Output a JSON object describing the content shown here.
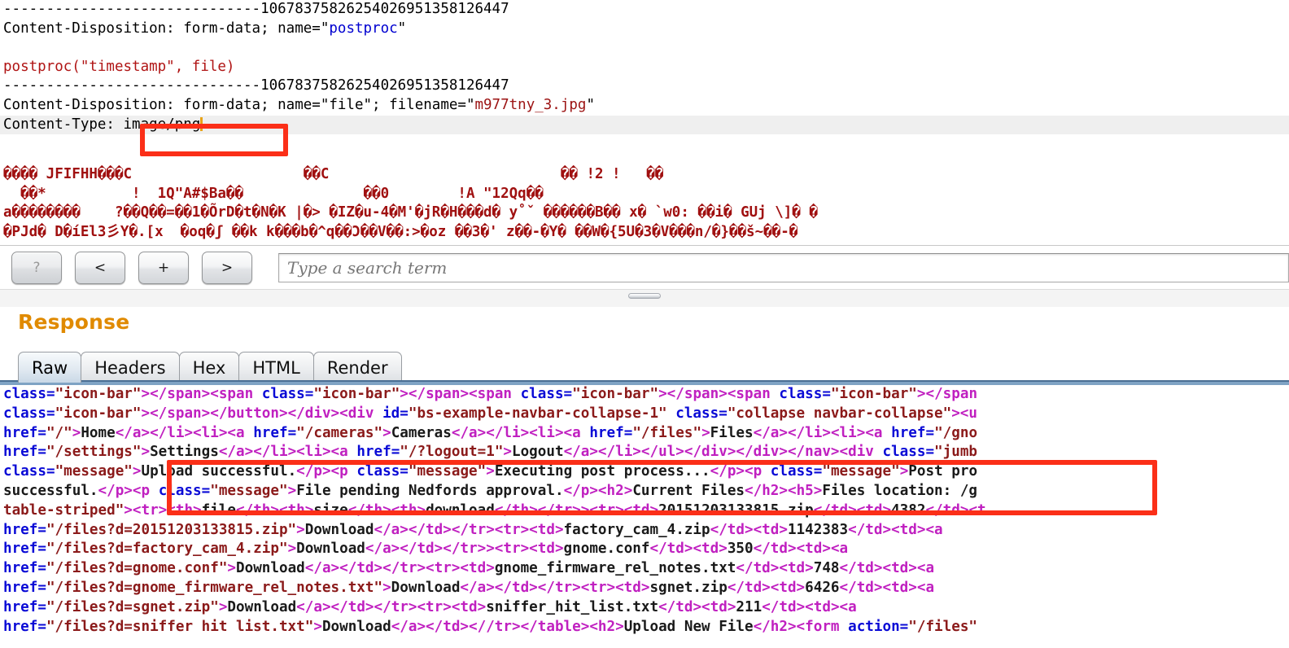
{
  "request": {
    "lines": [
      {
        "id": "boundary-1",
        "segments": [
          {
            "t": "------------------------------1067837582625402695135812644",
            "c": "plain"
          },
          {
            "t": "7",
            "c": "plain"
          }
        ]
      },
      {
        "id": "content-disposition-postproc",
        "segments": [
          {
            "t": "Content-Disposition: form-data; name=\"",
            "c": "plain"
          },
          {
            "t": "postproc",
            "c": "blue"
          },
          {
            "t": "\"",
            "c": "plain"
          }
        ]
      },
      {
        "id": "blank-1",
        "segments": [
          {
            "t": " ",
            "c": "plain"
          }
        ]
      },
      {
        "id": "postproc-call",
        "segments": [
          {
            "t": "postproc(\"timestamp\", file)",
            "c": "red"
          }
        ]
      },
      {
        "id": "boundary-2",
        "segments": [
          {
            "t": "------------------------------10678375826254026951358126447",
            "c": "plain"
          }
        ]
      },
      {
        "id": "content-disposition-file",
        "segments": [
          {
            "t": "Content-Disposition: form-data; name=\"file\"; filename=\"",
            "c": "plain"
          },
          {
            "t": "m977tny_3.jpg",
            "c": "dkred"
          },
          {
            "t": "\"",
            "c": "plain"
          }
        ]
      },
      {
        "id": "content-type-line",
        "segments": [
          {
            "t": "Content-Type: image/png",
            "c": "plain"
          }
        ],
        "highlight": true,
        "caret": true
      }
    ],
    "binary_lines": [
      "���� JFIFHH���C                    ��C                           �� !2 !   ��",
      "  ��*          !  1Q\"A#$Ba��              ��0        !A \"12Qq��",
      "a��������    ?��Q��=��1�ÕrD�t�N�K |�> �IZ�u-4�M'�jR�H���d� y˚ˇ ������B�� x� `w0: ��i� GUj \\]� �",
      "�PJd� D�íEl3彡Y�.[x  �oq�ʃ ��k k���b�^q��Ɔ��V��:>�oz ��3�' z��-�Y� ��W�{5U�3�V���n/�}��š~��-�"
    ]
  },
  "toolbar": {
    "buttons": [
      {
        "id": "help-button",
        "label": "?",
        "disabled": true
      },
      {
        "id": "prev-button",
        "label": "<",
        "disabled": false
      },
      {
        "id": "add-button",
        "label": "+",
        "disabled": false
      },
      {
        "id": "next-button",
        "label": ">",
        "disabled": false
      }
    ],
    "search": {
      "value": "",
      "placeholder": "Type a search term"
    }
  },
  "response": {
    "title": "Response",
    "tabs": [
      {
        "id": "tab-raw",
        "label": "Raw",
        "active": true
      },
      {
        "id": "tab-headers",
        "label": "Headers",
        "active": false
      },
      {
        "id": "tab-hex",
        "label": "Hex",
        "active": false
      },
      {
        "id": "tab-html",
        "label": "HTML",
        "active": false
      },
      {
        "id": "tab-render",
        "label": "Render",
        "active": false
      }
    ],
    "body_lines": [
      [
        {
          "t": "class=",
          "c": "attr"
        },
        {
          "t": "\"icon-bar\"",
          "c": "val"
        },
        {
          "t": "></span><span ",
          "c": "tag"
        },
        {
          "t": "class=",
          "c": "attr"
        },
        {
          "t": "\"icon-bar\"",
          "c": "val"
        },
        {
          "t": "></span><span ",
          "c": "tag"
        },
        {
          "t": "class=",
          "c": "attr"
        },
        {
          "t": "\"icon-bar\"",
          "c": "val"
        },
        {
          "t": "></span><span ",
          "c": "tag"
        },
        {
          "t": "class=",
          "c": "attr"
        },
        {
          "t": "\"icon-bar\"",
          "c": "val"
        },
        {
          "t": "></span",
          "c": "tag"
        }
      ],
      [
        {
          "t": "class=",
          "c": "attr"
        },
        {
          "t": "\"icon-bar\"",
          "c": "val"
        },
        {
          "t": "></span></button></div><div ",
          "c": "tag"
        },
        {
          "t": "id=",
          "c": "attr"
        },
        {
          "t": "\"bs-example-navbar-collapse-1\"",
          "c": "val"
        },
        {
          "t": " ",
          "c": "txt"
        },
        {
          "t": "class=",
          "c": "attr"
        },
        {
          "t": "\"collapse navbar-collapse\"",
          "c": "val"
        },
        {
          "t": "><u",
          "c": "tag"
        }
      ],
      [
        {
          "t": "href=",
          "c": "attr"
        },
        {
          "t": "\"/\"",
          "c": "val"
        },
        {
          "t": ">",
          "c": "tag"
        },
        {
          "t": "Home",
          "c": "txt"
        },
        {
          "t": "</a></li><li><a ",
          "c": "tag"
        },
        {
          "t": "href=",
          "c": "attr"
        },
        {
          "t": "\"/cameras\"",
          "c": "val"
        },
        {
          "t": ">",
          "c": "tag"
        },
        {
          "t": "Cameras",
          "c": "txt"
        },
        {
          "t": "</a></li><li><a ",
          "c": "tag"
        },
        {
          "t": "href=",
          "c": "attr"
        },
        {
          "t": "\"/files\"",
          "c": "val"
        },
        {
          "t": ">",
          "c": "tag"
        },
        {
          "t": "Files",
          "c": "txt"
        },
        {
          "t": "</a></li><li><a ",
          "c": "tag"
        },
        {
          "t": "href=",
          "c": "attr"
        },
        {
          "t": "\"/gno",
          "c": "val"
        }
      ],
      [
        {
          "t": "href=",
          "c": "attr"
        },
        {
          "t": "\"/settings\"",
          "c": "val"
        },
        {
          "t": ">",
          "c": "tag"
        },
        {
          "t": "Settings",
          "c": "txt"
        },
        {
          "t": "</a></li><li><a ",
          "c": "tag"
        },
        {
          "t": "href=",
          "c": "attr"
        },
        {
          "t": "\"/?logout=1\"",
          "c": "val"
        },
        {
          "t": ">",
          "c": "tag"
        },
        {
          "t": "Logout",
          "c": "txt"
        },
        {
          "t": "</a></li></ul></div></div></nav><div ",
          "c": "tag"
        },
        {
          "t": "class=",
          "c": "attr"
        },
        {
          "t": "\"jumb",
          "c": "val"
        }
      ],
      [
        {
          "t": "class=",
          "c": "attr"
        },
        {
          "t": "\"message\"",
          "c": "val"
        },
        {
          "t": ">",
          "c": "tag"
        },
        {
          "t": "Upload successful.",
          "c": "txt"
        },
        {
          "t": "</p><p ",
          "c": "tag"
        },
        {
          "t": "class=",
          "c": "attr"
        },
        {
          "t": "\"message\"",
          "c": "val"
        },
        {
          "t": ">",
          "c": "tag"
        },
        {
          "t": "Executing post process...",
          "c": "txt"
        },
        {
          "t": "</p><p ",
          "c": "tag"
        },
        {
          "t": "class=",
          "c": "attr"
        },
        {
          "t": "\"message\"",
          "c": "val"
        },
        {
          "t": ">",
          "c": "tag"
        },
        {
          "t": "Post pro",
          "c": "txt"
        }
      ],
      [
        {
          "t": "successful.",
          "c": "txt"
        },
        {
          "t": "</p>",
          "c": "tag"
        },
        {
          "t": "<p ",
          "c": "tag"
        },
        {
          "t": "class=",
          "c": "attr"
        },
        {
          "t": "\"message\"",
          "c": "val"
        },
        {
          "t": ">",
          "c": "tag"
        },
        {
          "t": "File pending Nedfords approval.",
          "c": "txt"
        },
        {
          "t": "</p><h2>",
          "c": "tag"
        },
        {
          "t": "Current Files",
          "c": "txt"
        },
        {
          "t": "</h2><h5>",
          "c": "tag"
        },
        {
          "t": "Files location: /g",
          "c": "txt"
        }
      ],
      [
        {
          "t": "table-striped\"",
          "c": "val"
        },
        {
          "t": "><tr><th>",
          "c": "tag"
        },
        {
          "t": "file",
          "c": "txt"
        },
        {
          "t": "</th><th>",
          "c": "tag"
        },
        {
          "t": "size",
          "c": "txt"
        },
        {
          "t": "</th><th>",
          "c": "tag"
        },
        {
          "t": "download",
          "c": "txt"
        },
        {
          "t": "</th></tr>",
          "c": "tag"
        },
        {
          "t": "><tr><td>",
          "c": "tag"
        },
        {
          "t": "20151203133815.zip",
          "c": "txt"
        },
        {
          "t": "</td><td>",
          "c": "tag"
        },
        {
          "t": "4382",
          "c": "txt"
        },
        {
          "t": "</td><t",
          "c": "tag"
        }
      ],
      [
        {
          "t": "href=",
          "c": "attr"
        },
        {
          "t": "\"/files?d=20151203133815.zip\"",
          "c": "val"
        },
        {
          "t": ">",
          "c": "tag"
        },
        {
          "t": "Download",
          "c": "txt"
        },
        {
          "t": "</a></td></tr>",
          "c": "tag"
        },
        {
          "t": "<tr><td>",
          "c": "tag"
        },
        {
          "t": "factory_cam_4.zip",
          "c": "txt"
        },
        {
          "t": "</td><td>",
          "c": "tag"
        },
        {
          "t": "1142383",
          "c": "txt"
        },
        {
          "t": "</td><td><a",
          "c": "tag"
        }
      ],
      [
        {
          "t": "href=",
          "c": "attr"
        },
        {
          "t": "\"/files?d=factory_cam_4.zip\"",
          "c": "val"
        },
        {
          "t": ">",
          "c": "tag"
        },
        {
          "t": "Download",
          "c": "txt"
        },
        {
          "t": "</a></td></tr>",
          "c": "tag"
        },
        {
          "t": "><tr><td>",
          "c": "tag"
        },
        {
          "t": "gnome.conf",
          "c": "txt"
        },
        {
          "t": "</td><td>",
          "c": "tag"
        },
        {
          "t": "350",
          "c": "txt"
        },
        {
          "t": "</td><td><a",
          "c": "tag"
        }
      ],
      [
        {
          "t": "href=",
          "c": "attr"
        },
        {
          "t": "\"/files?d=gnome.conf\"",
          "c": "val"
        },
        {
          "t": ">",
          "c": "tag"
        },
        {
          "t": "Download",
          "c": "txt"
        },
        {
          "t": "</a></td></tr><tr><td",
          "c": "tag"
        },
        {
          "t": ">",
          "c": "tag"
        },
        {
          "t": "gnome_firmware_rel_notes.txt",
          "c": "txt"
        },
        {
          "t": "</td><td>",
          "c": "tag"
        },
        {
          "t": "748",
          "c": "txt"
        },
        {
          "t": "</td><td><a",
          "c": "tag"
        }
      ],
      [
        {
          "t": "href=",
          "c": "attr"
        },
        {
          "t": "\"/files?d=gnome_firmware_rel_notes.txt\"",
          "c": "val"
        },
        {
          "t": ">",
          "c": "tag"
        },
        {
          "t": "Download",
          "c": "txt"
        },
        {
          "t": "</a",
          "c": "tag"
        },
        {
          "t": "></td></tr><tr><td>",
          "c": "tag"
        },
        {
          "t": "sgnet.zip",
          "c": "txt"
        },
        {
          "t": "</td><td>",
          "c": "tag"
        },
        {
          "t": "6426",
          "c": "txt"
        },
        {
          "t": "</td><td><a",
          "c": "tag"
        }
      ],
      [
        {
          "t": "href=",
          "c": "attr"
        },
        {
          "t": "\"/files?d=sgnet.zip\"",
          "c": "val"
        },
        {
          "t": ">",
          "c": "tag"
        },
        {
          "t": "Download",
          "c": "txt"
        },
        {
          "t": "</a></td></tr><tr><td>",
          "c": "tag"
        },
        {
          "t": "sniffer_hit_list.txt",
          "c": "txt"
        },
        {
          "t": "</td><td>",
          "c": "tag"
        },
        {
          "t": "211",
          "c": "txt"
        },
        {
          "t": "</td><td><a",
          "c": "tag"
        }
      ],
      [
        {
          "t": "href=",
          "c": "attr"
        },
        {
          "t": "\"/files?d=sniffer hit list.txt\"",
          "c": "val"
        },
        {
          "t": ">",
          "c": "tag"
        },
        {
          "t": "Download",
          "c": "txt"
        },
        {
          "t": "</a></td></",
          "c": "tag"
        },
        {
          "t": "/tr></table><h2>",
          "c": "tag"
        },
        {
          "t": "Upload New File",
          "c": "txt"
        },
        {
          "t": "</h2><form ",
          "c": "tag"
        },
        {
          "t": "action=",
          "c": "attr"
        },
        {
          "t": "\"/files\"",
          "c": "val"
        }
      ]
    ]
  },
  "annotations": {
    "content_type_box_color": "#fb2f18",
    "message_box_color": "#fb2f18"
  }
}
